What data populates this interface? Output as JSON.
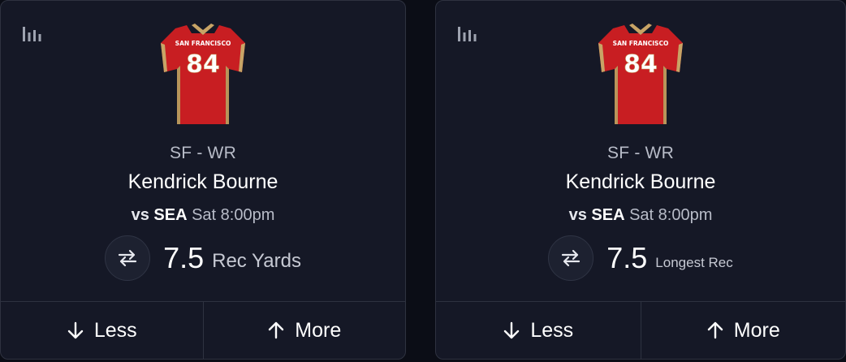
{
  "colors": {
    "background": "#0b0d16",
    "card": "#151826",
    "border": "#2e3240",
    "jersey_red": "#c81e22",
    "jersey_gold": "#c8a466"
  },
  "cards": [
    {
      "stats_icon": "bar-chart-icon",
      "jersey": {
        "team_text": "SAN FRANCISCO",
        "number": "84"
      },
      "position": "SF - WR",
      "player": "Kendrick Bourne",
      "matchup": {
        "vs": "vs",
        "opponent": "SEA",
        "time": "Sat 8:00pm"
      },
      "line": {
        "value": "7.5",
        "stat": "Rec Yards"
      },
      "swap_icon": "swap-arrows-icon",
      "less_label": "Less",
      "more_label": "More"
    },
    {
      "stats_icon": "bar-chart-icon",
      "jersey": {
        "team_text": "SAN FRANCISCO",
        "number": "84"
      },
      "position": "SF - WR",
      "player": "Kendrick Bourne",
      "matchup": {
        "vs": "vs",
        "opponent": "SEA",
        "time": "Sat 8:00pm"
      },
      "line": {
        "value": "7.5",
        "stat": "Longest Rec"
      },
      "swap_icon": "swap-arrows-icon",
      "less_label": "Less",
      "more_label": "More"
    }
  ]
}
